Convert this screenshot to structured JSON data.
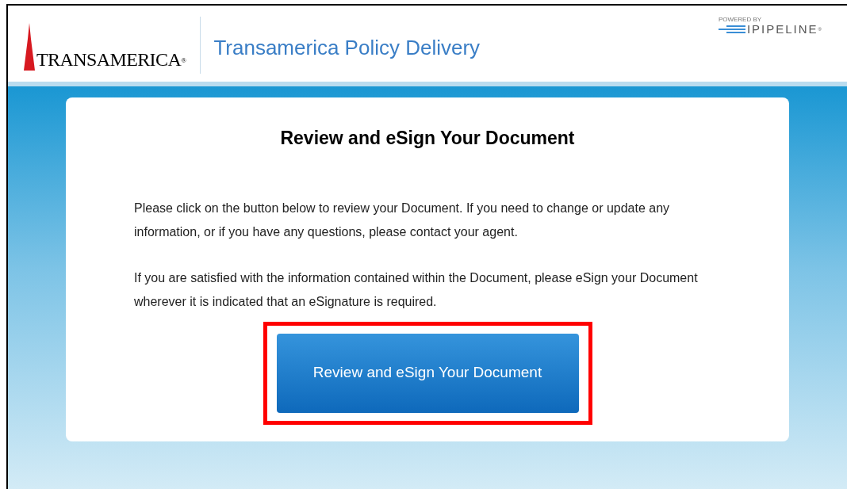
{
  "header": {
    "logo_text": "TRANSAMERICA",
    "logo_mark": "®",
    "title": "Transamerica Policy Delivery",
    "powered_by": "POWERED BY",
    "partner": "IPIPELINE",
    "partner_mark": "®"
  },
  "card": {
    "heading": "Review and eSign Your Document",
    "paragraphs": [
      "Please click on the button below to review your Document. If you need to change or update any information, or if you have any questions, please contact your agent.",
      "If you are satisfied with the information contained within the Document, please eSign your Document wherever it is indicated that an eSignature is required."
    ],
    "button": {
      "label": "Review and eSign Your Document",
      "highlighted": true
    }
  }
}
